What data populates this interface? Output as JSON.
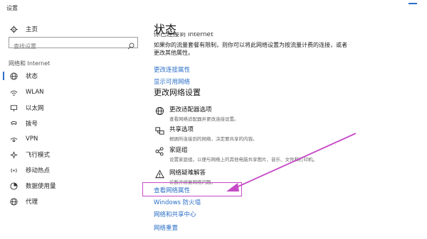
{
  "window": {
    "title": "设置"
  },
  "sidebar": {
    "home": "主页",
    "search_placeholder": "查找设置",
    "section": "网络和 Internet",
    "items": [
      {
        "label": "状态",
        "icon": "globe-icon"
      },
      {
        "label": "WLAN",
        "icon": "wifi-icon"
      },
      {
        "label": "以太网",
        "icon": "ethernet-icon"
      },
      {
        "label": "拨号",
        "icon": "dialup-icon"
      },
      {
        "label": "VPN",
        "icon": "vpn-icon"
      },
      {
        "label": "飞行模式",
        "icon": "airplane-icon"
      },
      {
        "label": "移动热点",
        "icon": "hotspot-icon"
      },
      {
        "label": "数据使用量",
        "icon": "data-usage-icon"
      },
      {
        "label": "代理",
        "icon": "proxy-globe-icon"
      }
    ]
  },
  "main": {
    "title": "状态",
    "clipped_line": "你已连接到 Internet",
    "description": "如果你的流量套餐有限制，则你可以将此网络设置为按流量计费的连接，或者更改其他属性。",
    "link_change_props": "更改连接属性",
    "link_show_networks": "显示可用网络",
    "subheading": "更改网络设置",
    "options": [
      {
        "title": "更改适配器选项",
        "desc": "查看网络适配器并更改连接设置。",
        "icon": "adapter-icon"
      },
      {
        "title": "共享选项",
        "desc": "根据所连接到的网络，决定要共享的内容。",
        "icon": "sharing-icon"
      },
      {
        "title": "家庭组",
        "desc": "设置家庭组，以便与网络上的其他电脑共享图片、音乐、文件和打印机。",
        "icon": "homegroup-icon"
      },
      {
        "title": "网络疑难解答",
        "desc": "诊断并修复网络问题。",
        "icon": "warning-icon"
      }
    ],
    "bottom_links": [
      "查看网络属性",
      "Windows 防火墙",
      "网络和共享中心",
      "网络重置"
    ]
  },
  "colors": {
    "accent": "#2b6fc7",
    "annotation": "#c64ac8"
  }
}
